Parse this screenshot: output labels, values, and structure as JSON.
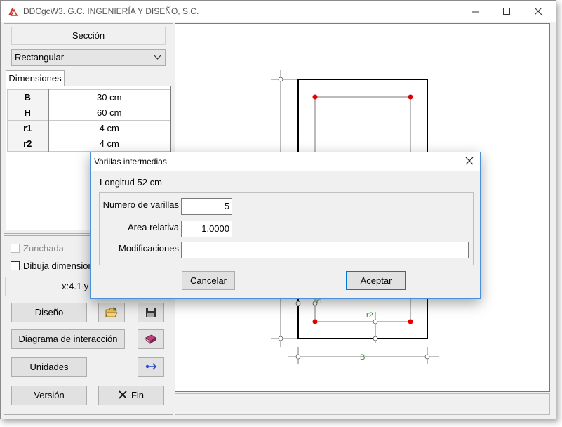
{
  "window": {
    "title": "DDCgcW3. G.C. INGENIERÍA Y DISEÑO, S.C.",
    "controls": {
      "minimize": "—",
      "maximize": "☐",
      "close": "✕"
    }
  },
  "left_panel": {
    "section_label": "Sección",
    "section_type": "Rectangular",
    "dims_tab": "Dimensiones",
    "dimensions": [
      {
        "key": "B",
        "value": "30 cm"
      },
      {
        "key": "H",
        "value": "60 cm"
      },
      {
        "key": "r1",
        "value": "4 cm"
      },
      {
        "key": "r2",
        "value": "4 cm"
      }
    ],
    "zunchada_label": "Zunchada",
    "dibuja_label": "Dibuja dimensiones",
    "coords": "x:4.1 y",
    "buttons": {
      "diseno": "Diseño",
      "diagrama": "Diagrama de interacción",
      "unidades": "Unidades",
      "version": "Versión",
      "fin": "Fin"
    }
  },
  "drawing": {
    "label_r2": "r2",
    "label_b": "B",
    "label_r1": "r1"
  },
  "dialog": {
    "title": "Varillas intermedias",
    "longitud": "Longitud 52 cm",
    "num_varillas_label": "Numero de varillas",
    "num_varillas_value": "5",
    "area_label": "Area relativa",
    "area_value": "1.0000",
    "modificaciones_label": "Modificaciones",
    "modificaciones_value": "",
    "cancel": "Cancelar",
    "accept": "Aceptar"
  },
  "colors": {
    "accent": "#0078d7",
    "rebar": "#e00000",
    "dimension_text": "#2e8b2e"
  }
}
